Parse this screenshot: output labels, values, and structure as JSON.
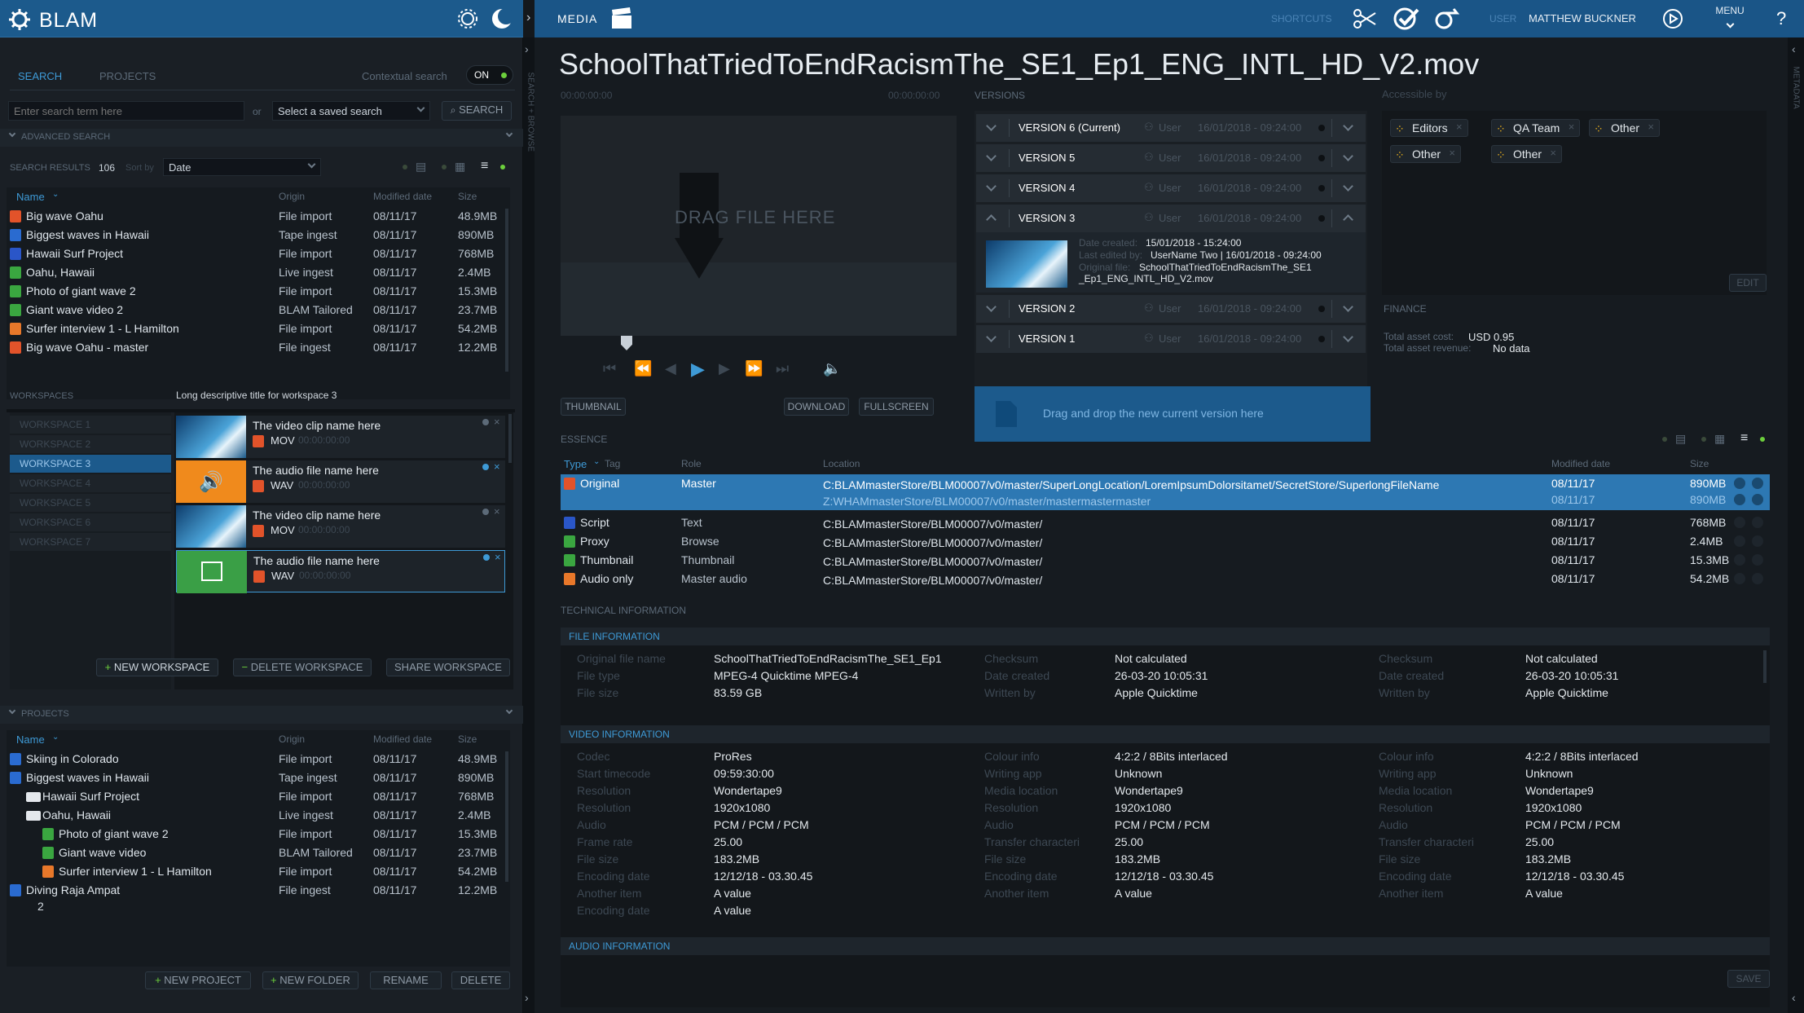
{
  "topbar": {
    "logo": "BLAM",
    "media_label": "MEDIA",
    "shortcuts_label": "SHORTCUTS",
    "user_label": "USER",
    "user_name": "MATTHEW BUCKNER",
    "menu_label": "MENU",
    "help": "?"
  },
  "left": {
    "tabs": [
      "SEARCH",
      "PROJECTS"
    ],
    "contextual_label": "Contextual search",
    "contextual_value": "ON",
    "search_placeholder": "Enter search term here",
    "or": "or",
    "saved_search": "Select a saved search",
    "search_btn": "SEARCH",
    "advanced": "ADVANCED SEARCH",
    "results_label": "SEARCH RESULTS",
    "results_count": "106",
    "sort_label": "Sort by",
    "sort_value": "Date",
    "columns": [
      "Name",
      "Origin",
      "Modified date",
      "Size"
    ],
    "results": [
      {
        "name": "Big wave Oahu",
        "origin": "File import",
        "date": "08/11/17",
        "size": "48.9MB",
        "icon": "#e2532a"
      },
      {
        "name": "Biggest waves in Hawaii",
        "origin": "Tape ingest",
        "date": "08/11/17",
        "size": "890MB",
        "icon": "#2a6bd0"
      },
      {
        "name": "Hawaii Surf Project",
        "origin": "File import",
        "date": "08/11/17",
        "size": "768MB",
        "icon": "#2a56c8"
      },
      {
        "name": "Oahu, Hawaii",
        "origin": "Live ingest",
        "date": "08/11/17",
        "size": "2.4MB",
        "icon": "#3aa640"
      },
      {
        "name": "Photo of giant wave 2",
        "origin": "File import",
        "date": "08/11/17",
        "size": "15.3MB",
        "icon": "#3aa640"
      },
      {
        "name": "Giant wave video 2",
        "origin": "BLAM Tailored",
        "date": "08/11/17",
        "size": "23.7MB",
        "icon": "#3aa640"
      },
      {
        "name": "Surfer interview 1 - L Hamilton",
        "origin": "File import",
        "date": "08/11/17",
        "size": "54.2MB",
        "icon": "#e8782a"
      },
      {
        "name": "Big wave Oahu - master",
        "origin": "File ingest",
        "date": "08/11/17",
        "size": "12.2MB",
        "icon": "#e2532a"
      }
    ],
    "workspaces_label": "WORKSPACES",
    "workspace_title": "Long descriptive title for workspace 3",
    "workspaces": [
      "WORKSPACE 1",
      "WORKSPACE 2",
      "WORKSPACE 3",
      "WORKSPACE 4",
      "WORKSPACE 5",
      "WORKSPACE 6",
      "WORKSPACE 7"
    ],
    "ws_items": [
      {
        "title": "The video clip name here",
        "fmt": "MOV",
        "tc": "00:00:00:00",
        "kind": "video"
      },
      {
        "title": "The audio file name here",
        "fmt": "WAV",
        "tc": "00:00:00:00",
        "kind": "audio"
      },
      {
        "title": "The video clip name here",
        "fmt": "MOV",
        "tc": "00:00:00:00",
        "kind": "video"
      },
      {
        "title": "The audio file name here",
        "fmt": "WAV",
        "tc": "00:00:00:00",
        "kind": "image"
      }
    ],
    "ws_buttons": [
      "NEW WORKSPACE",
      "DELETE WORKSPACE",
      "SHARE WORKSPACE"
    ],
    "projects_label": "PROJECTS",
    "projects": [
      {
        "name": "Skiing in Colorado",
        "origin": "File import",
        "date": "08/11/17",
        "size": "48.9MB",
        "indent": 0,
        "type": "proj"
      },
      {
        "name": "Biggest waves in Hawaii",
        "origin": "Tape ingest",
        "date": "08/11/17",
        "size": "890MB",
        "indent": 0,
        "type": "proj"
      },
      {
        "name": "Hawaii Surf Project",
        "origin": "File import",
        "date": "08/11/17",
        "size": "768MB",
        "indent": 1,
        "type": "folder"
      },
      {
        "name": "Oahu, Hawaii",
        "origin": "Live ingest",
        "date": "08/11/17",
        "size": "2.4MB",
        "indent": 1,
        "type": "folder"
      },
      {
        "name": "Photo of giant wave 2",
        "origin": "File import",
        "date": "08/11/17",
        "size": "15.3MB",
        "indent": 2,
        "type": "img"
      },
      {
        "name": "Giant wave video",
        "origin": "BLAM Tailored",
        "date": "08/11/17",
        "size": "23.7MB",
        "indent": 2,
        "type": "img"
      },
      {
        "name": "Surfer interview 1 - L Hamilton",
        "origin": "File import",
        "date": "08/11/17",
        "size": "54.2MB",
        "indent": 2,
        "type": "aud"
      },
      {
        "name": "Diving Raja Ampat",
        "origin": "File ingest",
        "date": "08/11/17",
        "size": "12.2MB",
        "indent": 0,
        "type": "proj"
      }
    ],
    "project_num": "2",
    "project_buttons": [
      "NEW PROJECT",
      "NEW FOLDER",
      "RENAME",
      "DELETE"
    ]
  },
  "side_strip": "SEARCH + BROWSE",
  "right_strip": "METADATA",
  "main": {
    "title": "SchoolThatTriedToEndRacismThe_SE1_Ep1_ENG_INTL_HD_V2.mov",
    "tc_start": "00:00:00:00",
    "tc_end": "00:00:00:00",
    "drag_text": "DRAG FILE HERE",
    "player_buttons": [
      "THUMBNAIL",
      "DOWNLOAD",
      "FULLSCREEN"
    ],
    "versions_label": "VERSIONS",
    "versions": [
      {
        "name": "VERSION 6 (Current)",
        "user": "User",
        "date": "16/01/2018 - 09:24:00"
      },
      {
        "name": "VERSION 5",
        "user": "User",
        "date": "16/01/2018 - 09:24:00"
      },
      {
        "name": "VERSION 4",
        "user": "User",
        "date": "16/01/2018 - 09:24:00"
      },
      {
        "name": "VERSION 3",
        "user": "User",
        "date": "16/01/2018 - 09:24:00"
      },
      {
        "name": "VERSION 2",
        "user": "User",
        "date": "16/01/2018 - 09:24:00"
      },
      {
        "name": "VERSION 1",
        "user": "User",
        "date": "16/01/2018 - 09:24:00"
      }
    ],
    "v3": {
      "created_k": "Date created:",
      "created_v": "15/01/2018 - 15:24:00",
      "edited_k": "Last edited by:",
      "edited_v": "UserName Two | 16/01/2018 - 09:24:00",
      "orig_k": "Original file:",
      "orig_v1": "SchoolThatTriedToEndRacismThe_SE1",
      "orig_v2": "_Ep1_ENG_INTL_HD_V2.mov"
    },
    "drop_text": "Drag and drop the new current version here",
    "accessible_label": "Accessible by",
    "tags": [
      "Editors",
      "QA Team",
      "Other",
      "Other",
      "Other"
    ],
    "edit_btn": "EDIT",
    "finance_label": "FINANCE",
    "finance": [
      {
        "k": "Total asset cost:",
        "v": "USD 0.95"
      },
      {
        "k": "Total asset revenue:",
        "v": "No data"
      }
    ],
    "essence_label": "ESSENCE",
    "essence_cols": [
      "Type",
      "Tag",
      "Role",
      "Location",
      "Modified date",
      "Size"
    ],
    "essence": [
      {
        "type": "Original",
        "role": "Master",
        "loc": "C:BLAMmasterStore/BLM00007/v0/master/SuperLongLocation/LoremIpsumDolorsitamet/SecretStore/SuperlongFileName",
        "loc2": "Z:WHAMmasterStore/BLM00007/v0/master/mastermastermaster",
        "date": "08/11/17",
        "date2": "08/11/17",
        "size": "890MB",
        "size2": "890MB",
        "icon": "#e2532a"
      },
      {
        "type": "Script",
        "role": "Text",
        "loc": "C:BLAMmasterStore/BLM00007/v0/master/",
        "date": "08/11/17",
        "size": "768MB",
        "icon": "#2a56c8"
      },
      {
        "type": "Proxy",
        "role": "Browse",
        "loc": "C:BLAMmasterStore/BLM00007/v0/master/",
        "date": "08/11/17",
        "size": "2.4MB",
        "icon": "#3aa640"
      },
      {
        "type": "Thumbnail",
        "role": "Thumbnail",
        "loc": "C:BLAMmasterStore/BLM00007/v0/master/",
        "date": "08/11/17",
        "size": "15.3MB",
        "icon": "#3aa640"
      },
      {
        "type": "Audio only",
        "role": "Master audio",
        "loc": "C:BLAMmasterStore/BLM00007/v0/master/",
        "date": "08/11/17",
        "size": "54.2MB",
        "icon": "#e8782a"
      }
    ],
    "tech_label": "TECHNICAL INFORMATION",
    "file_info_label": "FILE INFORMATION",
    "file_info": [
      [
        {
          "k": "Original file name",
          "v": "SchoolThatTriedToEndRacismThe_SE1_Ep1"
        },
        {
          "k": "Checksum",
          "v": "Not calculated"
        },
        {
          "k": "Checksum",
          "v": "Not calculated"
        }
      ],
      [
        {
          "k": "File type",
          "v": "MPEG-4 Quicktime MPEG-4"
        },
        {
          "k": "Date created",
          "v": "26-03-20  10:05:31"
        },
        {
          "k": "Date created",
          "v": "26-03-20  10:05:31"
        }
      ],
      [
        {
          "k": "File size",
          "v": "83.59 GB"
        },
        {
          "k": "Written by",
          "v": "Apple Quicktime"
        },
        {
          "k": "Written by",
          "v": "Apple Quicktime"
        }
      ]
    ],
    "video_info_label": "VIDEO INFORMATION",
    "video_info": [
      [
        {
          "k": "Codec",
          "v": "ProRes"
        },
        {
          "k": "Colour info",
          "v": "4:2:2 / 8Bits interlaced"
        },
        {
          "k": "Colour info",
          "v": "4:2:2 / 8Bits interlaced"
        }
      ],
      [
        {
          "k": "Start timecode",
          "v": "09:59:30:00"
        },
        {
          "k": "Writing app",
          "v": "Unknown"
        },
        {
          "k": "Writing app",
          "v": "Unknown"
        }
      ],
      [
        {
          "k": "Resolution",
          "v": "Wondertape9"
        },
        {
          "k": "Media location",
          "v": "Wondertape9"
        },
        {
          "k": "Media location",
          "v": "Wondertape9"
        }
      ],
      [
        {
          "k": "Resolution",
          "v": "1920x1080"
        },
        {
          "k": "Resolution",
          "v": "1920x1080"
        },
        {
          "k": "Resolution",
          "v": "1920x1080"
        }
      ],
      [
        {
          "k": "Audio",
          "v": "PCM / PCM / PCM"
        },
        {
          "k": "Audio",
          "v": "PCM / PCM / PCM"
        },
        {
          "k": "Audio",
          "v": "PCM / PCM / PCM"
        }
      ],
      [
        {
          "k": "Frame rate",
          "v": "25.00"
        },
        {
          "k": "Transfer characteri",
          "v": "25.00"
        },
        {
          "k": "Transfer characteri",
          "v": "25.00"
        }
      ],
      [
        {
          "k": "File size",
          "v": "183.2MB"
        },
        {
          "k": "File size",
          "v": "183.2MB"
        },
        {
          "k": "File size",
          "v": "183.2MB"
        }
      ],
      [
        {
          "k": "Encoding date",
          "v": "12/12/18 - 03.30.45"
        },
        {
          "k": "Encoding date",
          "v": "12/12/18 - 03.30.45"
        },
        {
          "k": "Encoding date",
          "v": "12/12/18 - 03.30.45"
        }
      ],
      [
        {
          "k": "Another item",
          "v": "A value"
        },
        {
          "k": "Another item",
          "v": "A value"
        },
        {
          "k": "Another item",
          "v": "A value"
        }
      ],
      [
        {
          "k": "Encoding date",
          "v": "A value"
        },
        {
          "k": "",
          "v": ""
        },
        {
          "k": "",
          "v": ""
        }
      ]
    ],
    "audio_info_label": "AUDIO INFORMATION",
    "save_btn": "SAVE"
  }
}
